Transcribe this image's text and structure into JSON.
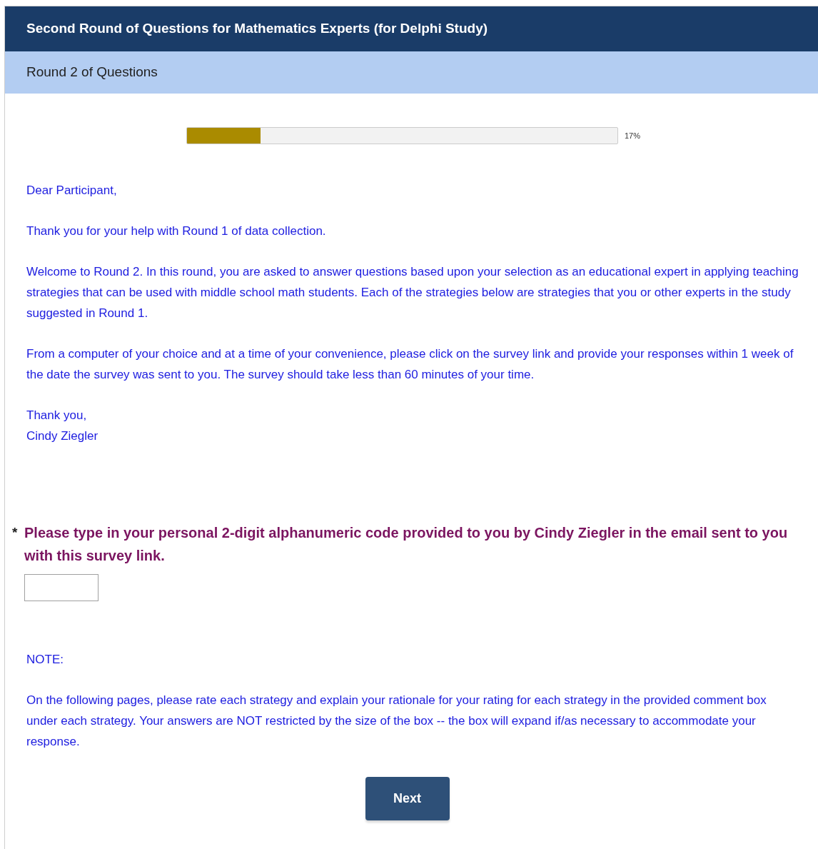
{
  "header": {
    "title": "Second Round of Questions for Mathematics Experts (for Delphi Study)"
  },
  "page_title": "Round 2 of Questions",
  "progress": {
    "level": 0.17,
    "label": "17%"
  },
  "message": {
    "paragraphs": [
      [
        "Dear Participant,"
      ],
      [
        "Thank you for your help with Round 1 of data collection."
      ],
      [
        "Welcome to Round 2. In this round, you are asked to answer questions based upon your selection as an educational expert in applying teaching strategies that can be used with middle school math students. Each of the strategies below are strategies that you or other experts in the study suggested in Round 1."
      ],
      [
        "From a computer of your choice and at a time of your convenience, please click on the survey link and provide your responses within 1 week of the date the survey was sent to you. The survey should take less than 60 minutes of your time."
      ],
      [
        "Thank you,",
        "Cindy Ziegler"
      ]
    ]
  },
  "question": {
    "required": true,
    "marker": "*",
    "text": "Please type in your personal 2-digit alphanumeric code provided to you by Cindy Ziegler in the email sent to you with this survey link."
  },
  "note": {
    "label": "NOTE:",
    "text": "On the following pages, please rate each strategy and explain your rationale for your rating for each strategy in the provided comment box under each strategy. Your answers are NOT restricted by the size of the box -- the box will expand if/as necessary to accommodate your response."
  },
  "buttons": [
    "Next"
  ]
}
